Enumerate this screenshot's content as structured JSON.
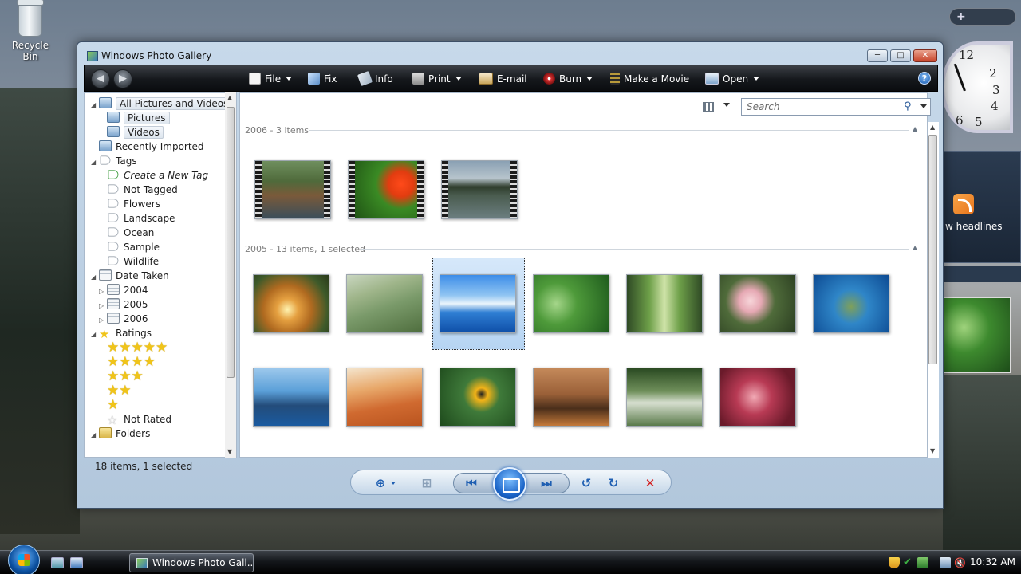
{
  "desktop": {
    "recycle_bin_label": "Recycle Bin",
    "gadgets": {
      "news_headlines": "w headlines"
    }
  },
  "window": {
    "title": "Windows Photo Gallery",
    "controls": {
      "minimize": "─",
      "maximize": "□",
      "close": "✕"
    }
  },
  "toolbar": {
    "back_icon": "back-arrow-icon",
    "forward_icon": "forward-arrow-icon",
    "file_label": "File",
    "fix_label": "Fix",
    "info_label": "Info",
    "print_label": "Print",
    "email_label": "E-mail",
    "burn_label": "Burn",
    "make_movie_label": "Make a Movie",
    "open_label": "Open",
    "help_label": "?"
  },
  "nav": {
    "all_pictures": "All Pictures and Videos",
    "pictures": "Pictures",
    "videos": "Videos",
    "recently_imported": "Recently Imported",
    "tags": "Tags",
    "create_tag": "Create a New Tag",
    "not_tagged": "Not Tagged",
    "tag_items": [
      "Flowers",
      "Landscape",
      "Ocean",
      "Sample",
      "Wildlife"
    ],
    "date_taken": "Date Taken",
    "years": [
      "2004",
      "2005",
      "2006"
    ],
    "ratings": "Ratings",
    "not_rated": "Not Rated",
    "folders": "Folders"
  },
  "search": {
    "placeholder": "Search"
  },
  "groups": [
    {
      "heading": "2006 - 3 items"
    },
    {
      "heading": "2005 - 13 items, 1 selected"
    }
  ],
  "status": {
    "text": "18 items, 1 selected"
  },
  "taskbar": {
    "active_window": "Windows Photo Gall...",
    "clock": "10:32 AM"
  },
  "colors": {
    "toolbar_bg": "#15181c",
    "selection": "#b6d4f2",
    "accent": "#1f5fb2"
  }
}
